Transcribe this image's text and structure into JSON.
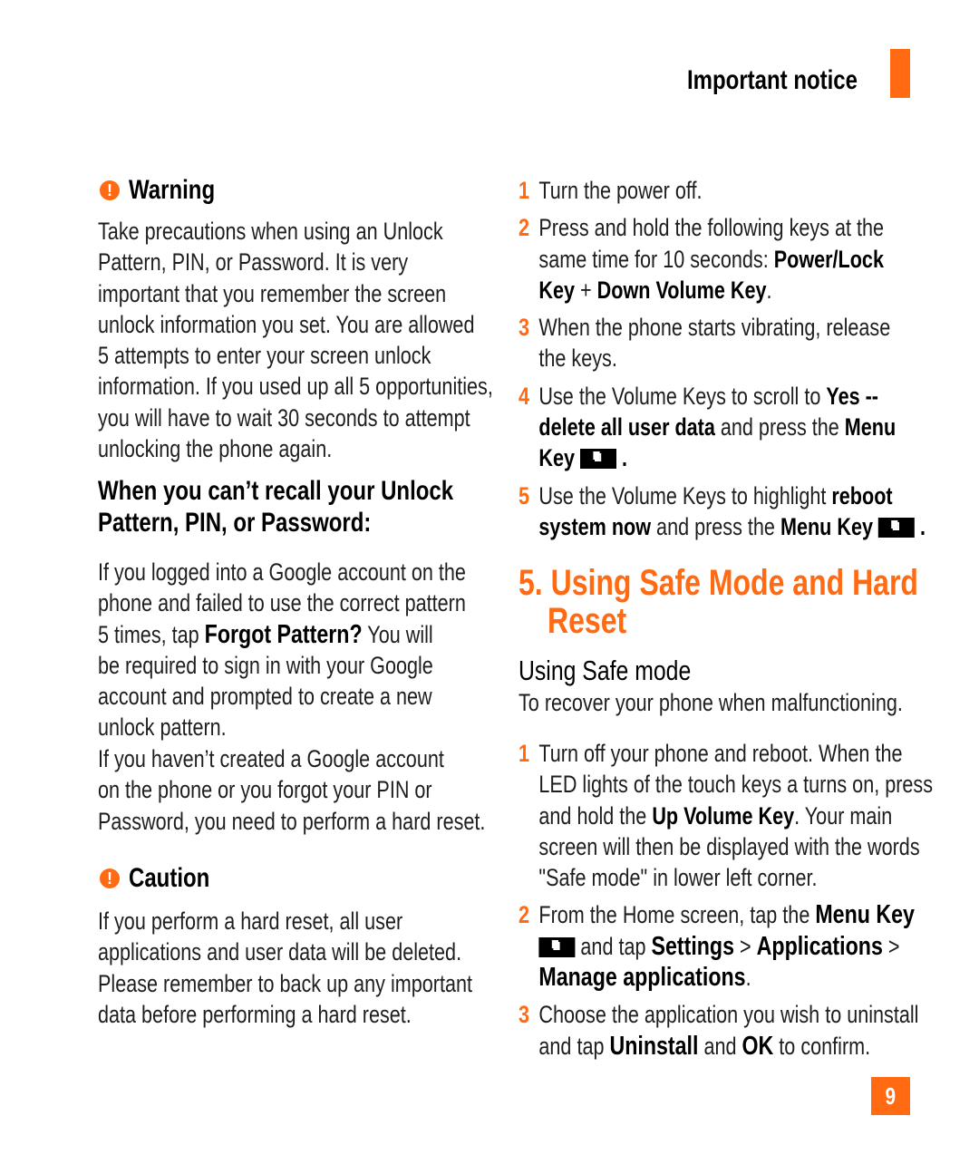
{
  "header": {
    "title": "Important notice",
    "accent_color": "#ff6a13"
  },
  "left_column": {
    "warning": {
      "icon": "exclamation-circle-icon",
      "title": "Warning",
      "lines": [
        "Take precautions when using an Unlock",
        "Pattern, PIN, or Password. It is very",
        "important that you remember the screen",
        "unlock information you set. You are allowed",
        "5 attempts to enter your screen unlock",
        "information. If you used up all 5 opportunities,",
        "you will have to wait 30 seconds to attempt",
        "unlocking the phone again."
      ]
    },
    "recall": {
      "heading_lines": [
        "When you can’t recall your Unlock",
        "Pattern, PIN, or Password:"
      ],
      "para1": {
        "line1": "If you logged into a Google account on the",
        "line2": "phone and failed to use the correct pattern",
        "line3_pre": "5 times, tap ",
        "line3_bold": "Forgot Pattern?",
        "line3_post": " You will",
        "line4": "be required to sign in with your Google",
        "line5": "account and prompted to create a new",
        "line6": "unlock pattern."
      },
      "para2_lines": [
        "If you haven’t created a Google account",
        "on the phone or you forgot your PIN or",
        "Password, you need to perform a hard reset."
      ]
    },
    "caution": {
      "icon": "exclamation-circle-icon",
      "title": "Caution",
      "lines": [
        "If you perform a hard reset, all user",
        "applications and user data will be deleted.",
        "Please remember to back up any important",
        "data before performing a hard reset."
      ]
    }
  },
  "right_column": {
    "hard_reset_steps": [
      {
        "num": "1",
        "text": "Turn the power off."
      },
      {
        "num": "2",
        "l1": "Press and hold the following keys at the",
        "l2_pre": "same time for 10 seconds: ",
        "l2_bold": "Power/Lock",
        "l3_bold1": "Key",
        "l3_plus": " + ",
        "l3_bold2": "Down Volume Key",
        "l3_post": "."
      },
      {
        "num": "3",
        "l1": "When the phone starts vibrating, release",
        "l2": "the keys."
      },
      {
        "num": "4",
        "l1_pre": "Use the Volume Keys to scroll to ",
        "l1_bold": "Yes --",
        "l2_bold": "delete all user data",
        "l2_mid": " and press the ",
        "l2_bold2": "Menu",
        "l3_bold": "Key",
        "l3_post": ".",
        "key_icon": "menu-key-icon"
      },
      {
        "num": "5",
        "l1_pre": "Use the Volume Keys to highlight ",
        "l1_bold": "reboot",
        "l2_bold": "system now",
        "l2_mid": " and press the ",
        "l2_bold2": "Menu Key",
        "l2_post": ".",
        "key_icon": "menu-key-icon"
      }
    ],
    "section": {
      "title_l1": "5. Using Safe Mode and Hard",
      "title_l2": "Reset",
      "subtitle": "Using Safe mode",
      "intro": "To recover your phone when malfunctioning."
    },
    "safe_mode_steps": [
      {
        "num": "1",
        "l1": "Turn off your phone and reboot. When the",
        "l2": "LED lights of the touch keys a turns on, press",
        "l3_pre": "and hold the ",
        "l3_bold": "Up Volume Key",
        "l3_post": ". Your main",
        "l4": "screen will then be displayed with the words",
        "l5": "\"Safe mode\" in lower left corner."
      },
      {
        "num": "2",
        "l1_pre": "From the Home screen, tap the ",
        "l1_bold": "Menu Key",
        "l2_mid": " and tap ",
        "l2_bold1": "Settings",
        "l2_sep1": " > ",
        "l2_bold2": "Applications",
        "l2_sep2": " >",
        "l3_bold": "Manage applications",
        "l3_post": ".",
        "key_icon": "menu-key-icon"
      },
      {
        "num": "3",
        "l1": "Choose the application you wish to uninstall",
        "l2_pre": "and tap ",
        "l2_bold1": "Uninstall",
        "l2_mid": " and ",
        "l2_bold2": "OK",
        "l2_post": " to confirm."
      }
    ]
  },
  "page_number": "9"
}
